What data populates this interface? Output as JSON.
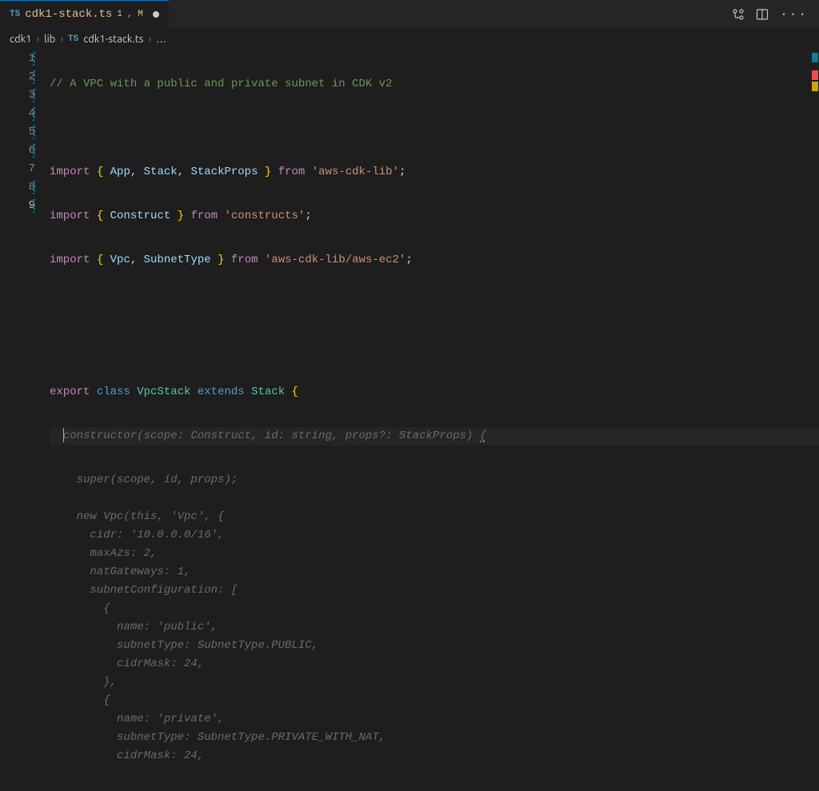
{
  "tab": {
    "icon_label": "TS",
    "filename": "cdk1-stack.ts",
    "problem_count": "1",
    "git_status": "M"
  },
  "breadcrumbs": {
    "seg1": "cdk1",
    "seg2": "lib",
    "icon_label": "TS",
    "seg3": "cdk1-stack.ts",
    "tail": "…"
  },
  "gutter": {
    "l1": "1",
    "l2": "2",
    "l3": "3",
    "l4": "4",
    "l5": "5",
    "l6": "6",
    "l7": "7",
    "l8": "8",
    "l9": "9"
  },
  "code": {
    "l1_comment": "// A VPC with a public and private subnet in CDK v2",
    "l3": {
      "kw_import": "import",
      "names": "App, Stack, StackProps",
      "kw_from": "from",
      "mod": "'aws-cdk-lib'"
    },
    "l4": {
      "kw_import": "import",
      "names": "Construct",
      "kw_from": "from",
      "mod": "'constructs'"
    },
    "l5": {
      "kw_import": "import",
      "names": "Vpc, SubnetType",
      "kw_from": "from",
      "mod": "'aws-cdk-lib/aws-ec2'"
    },
    "l8": {
      "kw_export": "export",
      "kw_class": "class",
      "name": "VpcStack",
      "kw_extends": "extends",
      "base": "Stack"
    },
    "l9_suggest_first": "constructor(scope: Construct, id: string, props?: StackProps) ",
    "l9_brace": "{"
  },
  "suggestion_lines": [
    "    super(scope, id, props);",
    "",
    "    new Vpc(this, 'Vpc', {",
    "      cidr: '10.0.0.0/16',",
    "      maxAzs: 2,",
    "      natGateways: 1,",
    "      subnetConfiguration: [",
    "        {",
    "          name: 'public',",
    "          subnetType: SubnetType.PUBLIC,",
    "          cidrMask: 24,",
    "        },",
    "        {",
    "          name: 'private',",
    "          subnetType: SubnetType.PRIVATE_WITH_NAT,",
    "          cidrMask: 24,"
  ],
  "colors": {
    "active_tab_border": "#007acc",
    "modified_git": "#e2c08d",
    "error": "#f14c4c",
    "suggestion_text": "#6b6b6b"
  }
}
